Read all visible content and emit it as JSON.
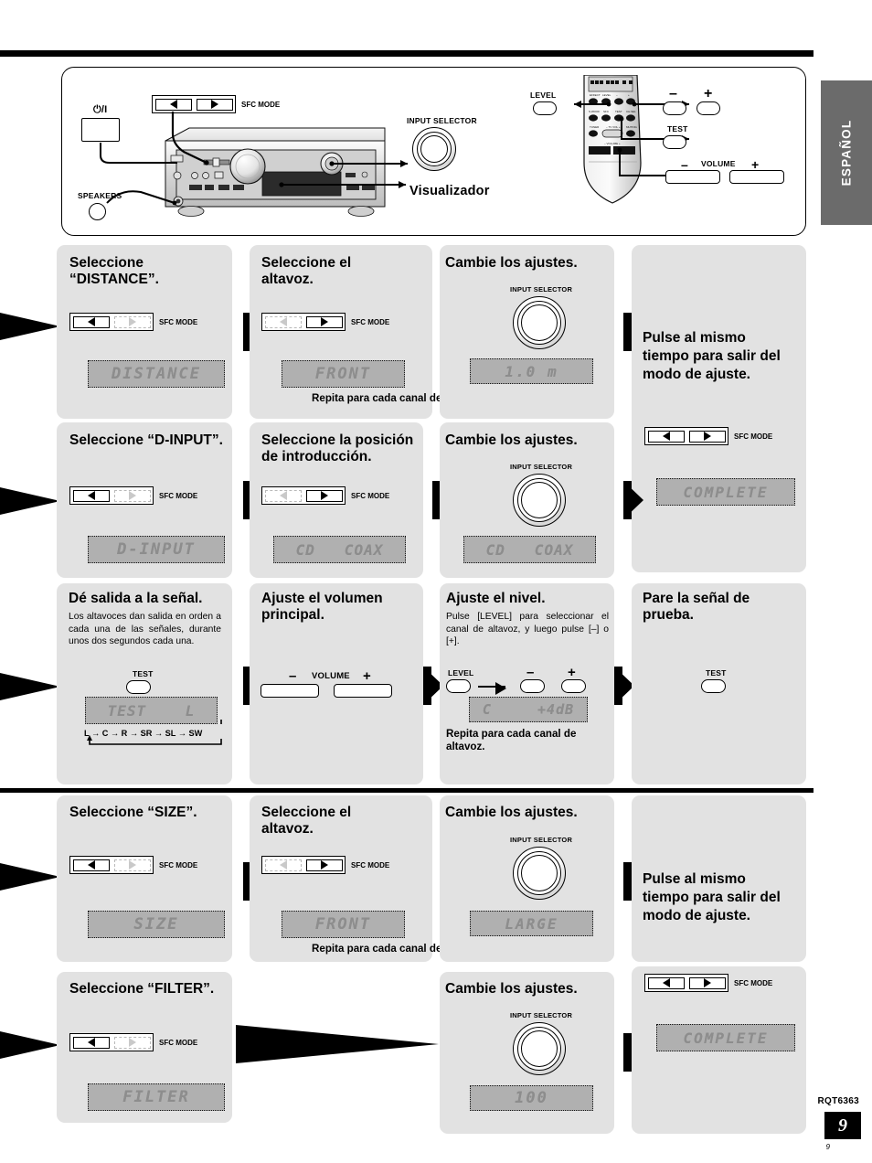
{
  "page": {
    "language_tab": "ESPAÑOL",
    "doc_code": "RQT6363",
    "page_number": "9",
    "page_number_small": "9"
  },
  "hero": {
    "power_icon": "⏻/I",
    "speakers_label": "SPEAKERS",
    "sfc_mode_label": "SFC MODE",
    "input_selector_label": "INPUT SELECTOR",
    "display_callout": "Visualizador",
    "remote": {
      "level_label": "LEVEL",
      "minus_label": "–",
      "plus_label": "+",
      "test_label": "TEST",
      "volume_label": "VOLUME",
      "volume_minus": "–",
      "volume_plus": "+"
    }
  },
  "common": {
    "sfc_mode_label": "SFC MODE",
    "input_selector_label": "INPUT SELECTOR",
    "repeat_note": "Repita para cada canal de altavoz.",
    "exit_note": "Pulse al mismo tiempo para salir del modo de ajuste.",
    "change_settings_title": "Cambie los ajustes.",
    "select_speaker_title": "Seleccione el altavoz.",
    "complete_display": "COMPLETE"
  },
  "sections": [
    {
      "id": "distance",
      "steps": [
        {
          "title": "Seleccione “DISTANCE”.",
          "control": "sfc-left",
          "display": "DISTANCE"
        },
        {
          "title": "Seleccione el altavoz.",
          "control": "sfc-right",
          "display": "FRONT",
          "note": "Repita para cada canal de altavoz."
        },
        {
          "title": "Cambie los ajustes.",
          "control": "input-selector",
          "display": "1.0 m"
        },
        {
          "title": "Pulse al mismo tiempo para salir del modo de ajuste.",
          "control": "sfc-both",
          "display": "COMPLETE"
        }
      ]
    },
    {
      "id": "d-input",
      "steps": [
        {
          "title": "Seleccione “D-INPUT”.",
          "control": "sfc-left",
          "display": "D-INPUT"
        },
        {
          "title": "Seleccione la posición de introducción.",
          "control": "sfc-right",
          "display": "CD   COAX"
        },
        {
          "title": "Cambie los ajustes.",
          "control": "input-selector",
          "display": "CD   COAX"
        },
        {
          "title": "Pulse al mismo tiempo para salir del modo de ajuste.",
          "control": "sfc-both",
          "display": "COMPLETE"
        }
      ]
    },
    {
      "id": "test-signal",
      "steps": [
        {
          "title": "Dé salida a la señal.",
          "body": "Los altavoces dan salida en orden a cada una de las señales, durante unos dos segundos cada una.",
          "control": "test-button",
          "control_label": "TEST",
          "display": "TEST    L",
          "sequence": "L → C → R → SR → SL → SW"
        },
        {
          "title": "Ajuste el volumen principal.",
          "control": "volume-pair",
          "volume_label": "VOLUME",
          "minus": "–",
          "plus": "+"
        },
        {
          "title": "Ajuste el nivel.",
          "body": "Pulse [LEVEL] para seleccionar el canal de altavoz, y luego pulse [–] o [+].",
          "control": "level-minus-plus",
          "level_label": "LEVEL",
          "minus": "–",
          "plus": "+",
          "display": "C     +4dB",
          "note": "Repita para cada canal de altavoz."
        },
        {
          "title": "Pare la señal de prueba.",
          "control": "test-button",
          "control_label": "TEST"
        }
      ]
    },
    {
      "id": "size",
      "steps": [
        {
          "title": "Seleccione “SIZE”.",
          "control": "sfc-left",
          "display": "SIZE"
        },
        {
          "title": "Seleccione el altavoz.",
          "control": "sfc-right",
          "display": "FRONT",
          "note": "Repita para cada canal de altavoz."
        },
        {
          "title": "Cambie los ajustes.",
          "control": "input-selector",
          "display": "LARGE"
        },
        {
          "title": "Pulse al mismo tiempo para salir del modo de ajuste.",
          "control": "sfc-both",
          "display": "COMPLETE"
        }
      ]
    },
    {
      "id": "filter",
      "steps": [
        {
          "title": "Seleccione “FILTER”.",
          "control": "sfc-left",
          "display": "FILTER"
        },
        {
          "title": "Cambie los ajustes.",
          "control": "input-selector",
          "display": "100"
        },
        {
          "title": "",
          "control": "sfc-both",
          "display": "COMPLETE"
        }
      ]
    }
  ]
}
